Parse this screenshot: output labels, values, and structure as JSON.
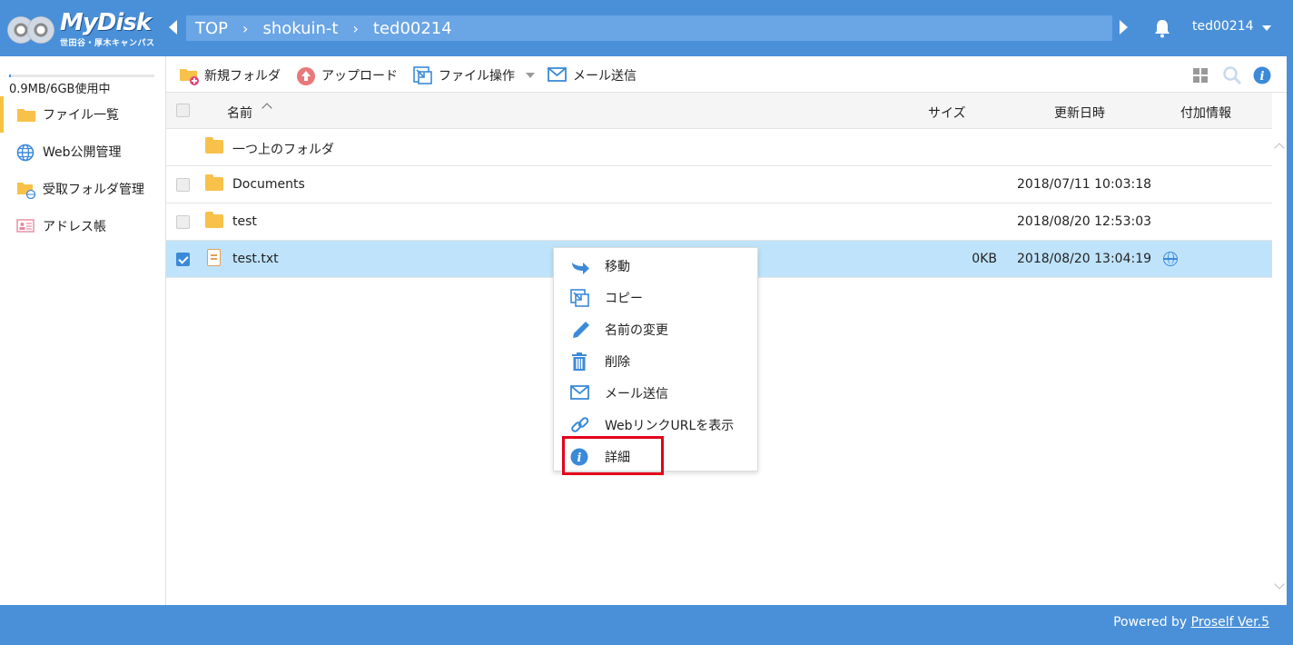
{
  "app": {
    "logo_text": "MyDisk",
    "logo_sub": "世田谷・厚木キャンパス"
  },
  "breadcrumb": [
    "TOP",
    "shokuin-t",
    "ted00214"
  ],
  "user": {
    "name": "ted00214"
  },
  "sidebar": {
    "usage_text": "0.9MB/6GB使用中",
    "usage_fraction": 0.00015,
    "items": [
      {
        "label": "ファイル一覧",
        "icon": "folder-icon",
        "active": true
      },
      {
        "label": "Web公開管理",
        "icon": "globe-icon"
      },
      {
        "label": "受取フォルダ管理",
        "icon": "receive-folder-icon"
      },
      {
        "label": "アドレス帳",
        "icon": "address-book-icon"
      }
    ]
  },
  "toolbar": {
    "new_folder": "新規フォルダ",
    "upload": "アップロード",
    "file_ops": "ファイル操作",
    "send_mail": "メール送信"
  },
  "table": {
    "columns": {
      "name": "名前",
      "size": "サイズ",
      "updated": "更新日時",
      "info": "付加情報"
    },
    "rows": [
      {
        "name": "一つ上のフォルダ",
        "type": "folder",
        "size": "",
        "updated": "",
        "checkbox": false
      },
      {
        "name": "Documents",
        "type": "folder",
        "size": "",
        "updated": "2018/07/11 10:03:18",
        "checkbox": true
      },
      {
        "name": "test",
        "type": "folder",
        "size": "",
        "updated": "2018/08/20 12:53:03",
        "checkbox": true
      },
      {
        "name": "test.txt",
        "type": "file",
        "size": "0KB",
        "updated": "2018/08/20 13:04:19",
        "checkbox": true,
        "checked": true,
        "web_public": true
      }
    ]
  },
  "context_menu": {
    "items": [
      {
        "label": "移動",
        "icon": "move-icon"
      },
      {
        "label": "コピー",
        "icon": "copy-icon"
      },
      {
        "label": "名前の変更",
        "icon": "rename-icon"
      },
      {
        "label": "削除",
        "icon": "trash-icon"
      },
      {
        "label": "メール送信",
        "icon": "mail-icon"
      },
      {
        "label": "WebリンクURLを表示",
        "icon": "link-icon"
      },
      {
        "label": "詳細",
        "icon": "info-icon"
      }
    ]
  },
  "footer": {
    "prefix": "Powered by ",
    "link": "Proself Ver.5"
  },
  "colors": {
    "brand": "#4a90d9",
    "selected_row": "#bfe3fb",
    "highlight": "#e2001a",
    "folder": "#f7c14a"
  }
}
